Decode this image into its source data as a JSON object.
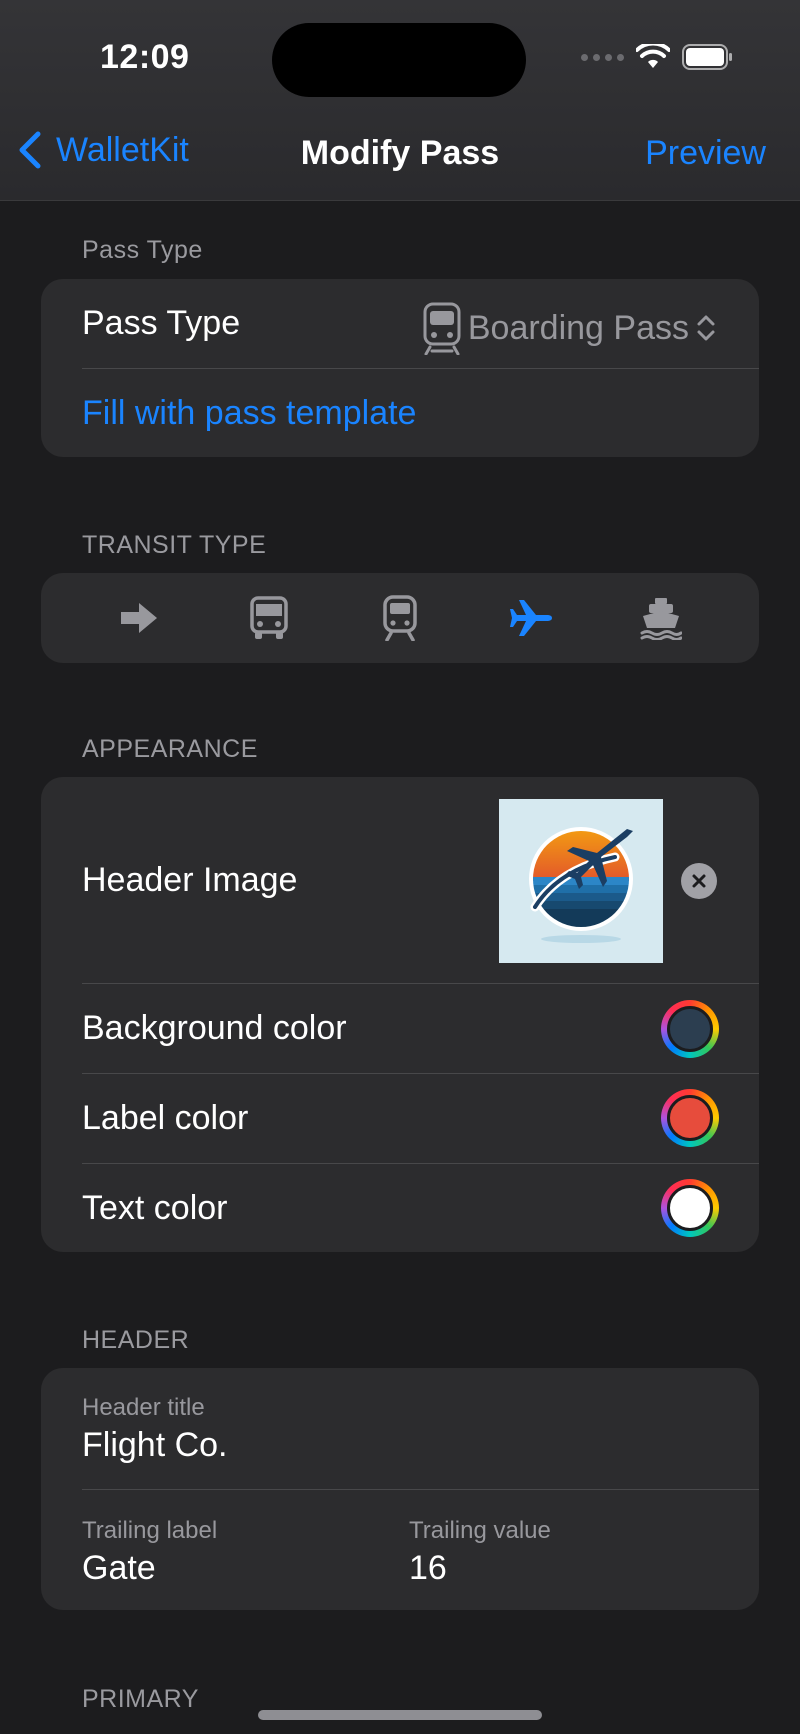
{
  "status_bar": {
    "time": "12:09"
  },
  "nav": {
    "back_label": "WalletKit",
    "title": "Modify Pass",
    "action_label": "Preview"
  },
  "pass_type_section": {
    "header": "Pass Type",
    "row_label": "Pass Type",
    "selected_value": "Boarding Pass",
    "selected_icon": "tram-icon",
    "template_link": "Fill with pass template"
  },
  "transit_section": {
    "header": "TRANSIT TYPE",
    "options": [
      {
        "icon": "arrow-right-icon",
        "selected": false
      },
      {
        "icon": "bus-icon",
        "selected": false
      },
      {
        "icon": "train-icon",
        "selected": false
      },
      {
        "icon": "airplane-icon",
        "selected": true
      },
      {
        "icon": "boat-icon",
        "selected": false
      }
    ],
    "accent_color": "#1a84ff",
    "inactive_color": "#98989d"
  },
  "appearance_section": {
    "header": "APPEARANCE",
    "header_image_label": "Header Image",
    "background_color_label": "Background color",
    "background_color": "#2c3e50",
    "label_color_label": "Label color",
    "label_color": "#e74c3c",
    "text_color_label": "Text color",
    "text_color": "#ffffff"
  },
  "header_section": {
    "header": "HEADER",
    "header_title_caption": "Header title",
    "header_title_value": "Flight Co.",
    "trailing_label_caption": "Trailing label",
    "trailing_label_value": "Gate",
    "trailing_value_caption": "Trailing value",
    "trailing_value_value": "16"
  },
  "primary_section": {
    "header": "PRIMARY"
  }
}
